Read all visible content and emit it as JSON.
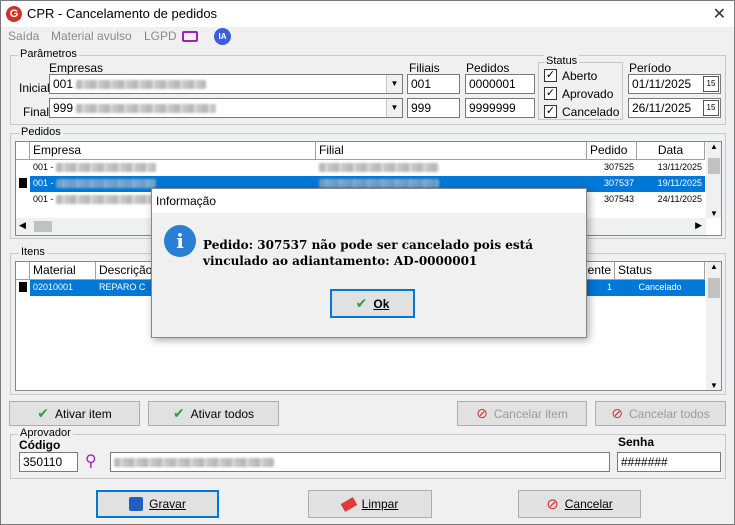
{
  "window": {
    "title": "CPR - Cancelamento de pedidos",
    "app_icon": "G"
  },
  "menu": {
    "items": [
      "Saída",
      "Material avulso",
      "LGPD"
    ],
    "ia_label": "IA"
  },
  "parametros": {
    "label": "Parâmetros",
    "empresas_label": "Empresas",
    "filiais_label": "Filiais",
    "pedidos_label": "Pedidos",
    "inicial_label": "Inicial",
    "final_label": "Final",
    "empresa_inicial": "001",
    "empresa_final": "999",
    "filial_inicial": "001",
    "filial_final": "999",
    "pedido_inicial": "0000001",
    "pedido_final": "9999999"
  },
  "status": {
    "label": "Status",
    "aberto": "Aberto",
    "aprovado": "Aprovado",
    "cancelado": "Cancelado"
  },
  "periodo": {
    "label": "Período",
    "inicio": "01/11/2025",
    "fim": "26/11/2025",
    "cal_icon": "15"
  },
  "pedidos": {
    "label": "Pedidos",
    "columns": [
      "Empresa",
      "Filial",
      "Pedido",
      "Data"
    ],
    "rows": [
      {
        "empresa": "001 -",
        "pedido": "307525",
        "data": "13/11/2025"
      },
      {
        "empresa": "001 -",
        "pedido": "307537",
        "data": "19/11/2025"
      },
      {
        "empresa": "001 -",
        "pedido": "307543",
        "data": "24/11/2025"
      }
    ]
  },
  "itens": {
    "label": "Itens",
    "columns": [
      "Material",
      "Descrição",
      "dente",
      "Status"
    ],
    "rows": [
      {
        "material": "02010001",
        "descricao": "REPARO C",
        "pendente": "1",
        "status": "Cancelado"
      }
    ]
  },
  "actions": {
    "ativar_item": "Ativar item",
    "ativar_todos": "Ativar todos",
    "cancelar_item": "Cancelar item",
    "cancelar_todos": "Cancelar todos"
  },
  "aprovador": {
    "label": "Aprovador",
    "codigo_label": "Código",
    "codigo": "350110",
    "senha_label": "Senha",
    "senha": "#######"
  },
  "footer": {
    "gravar": "Gravar",
    "limpar": "Limpar",
    "cancelar": "Cancelar"
  },
  "dialog": {
    "title": "Informação",
    "message": "Pedido: 307537 não pode ser cancelado pois está vinculado ao adiantamento: AD-0000001",
    "ok": "Ok"
  },
  "colors": {
    "accent": "#0078d7",
    "ok_green": "#2ea043",
    "cancel_red": "#d0312d",
    "info_blue": "#2a7fd4"
  }
}
